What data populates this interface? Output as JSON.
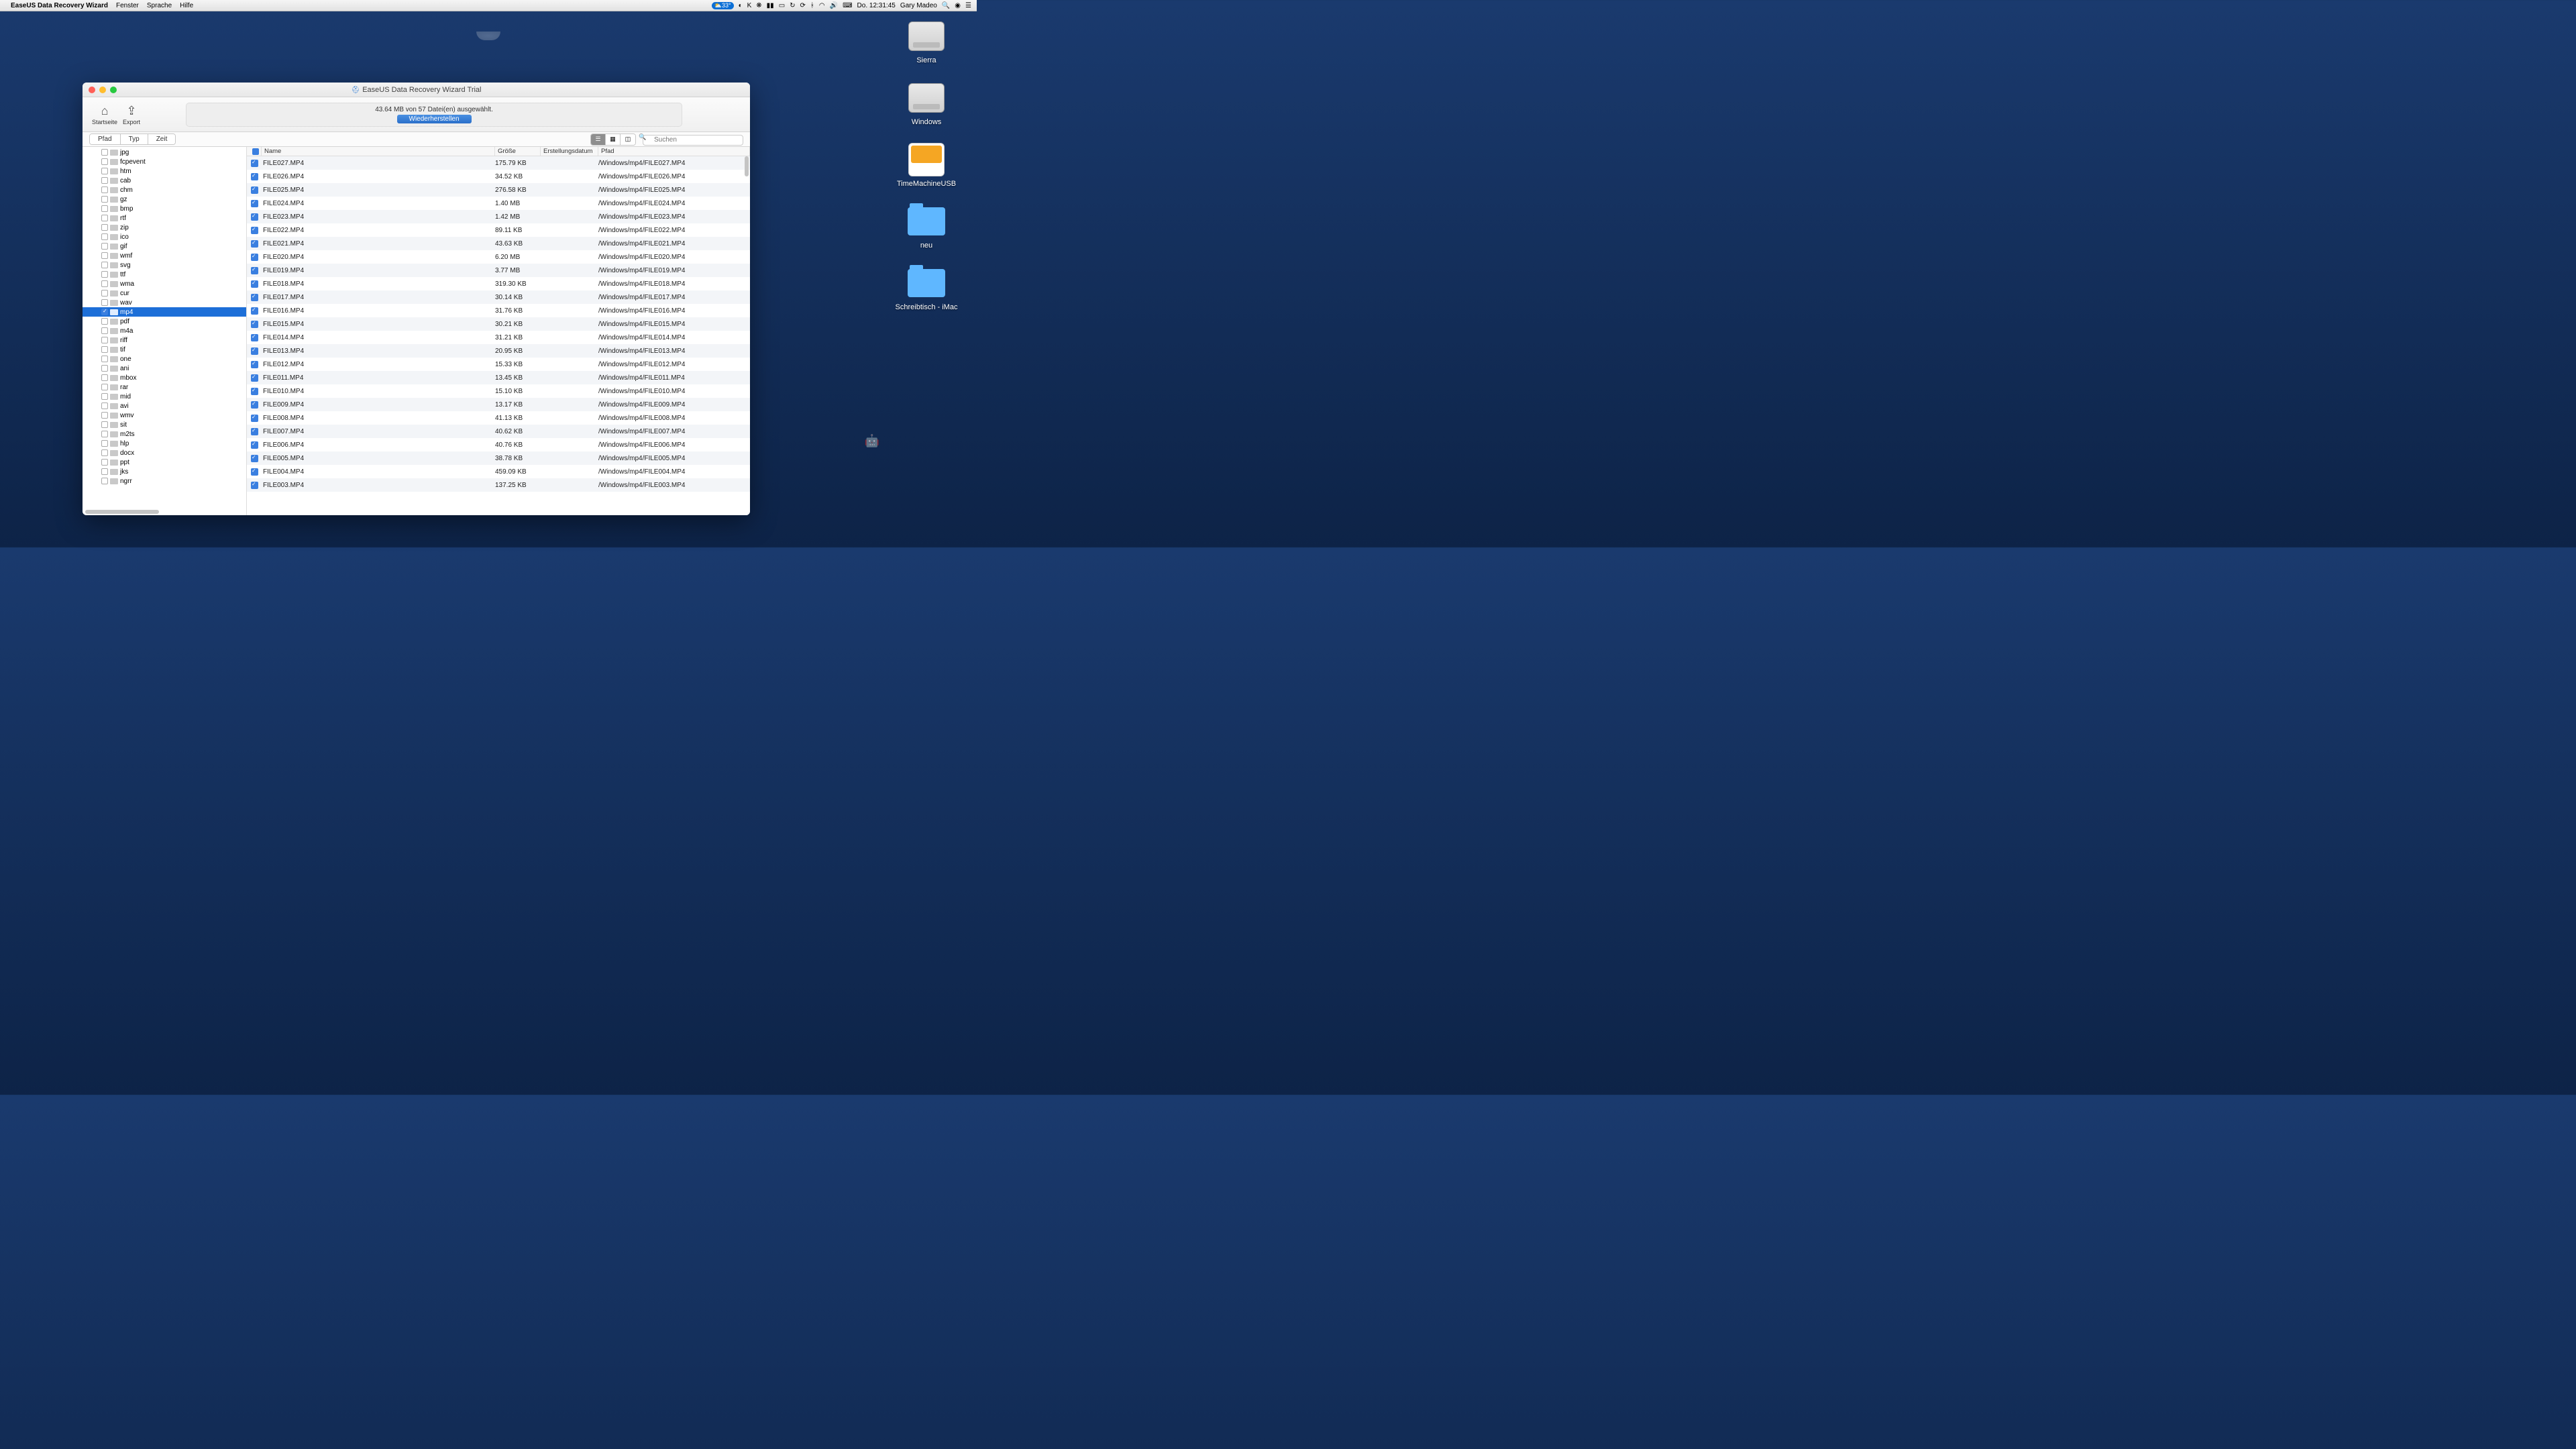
{
  "menubar": {
    "app_name": "EaseUS Data Recovery Wizard",
    "menus": [
      "Fenster",
      "Sprache",
      "Hilfe"
    ],
    "right": {
      "badge": "⛅33°",
      "clock": "Do. 12:31:45",
      "user": "Gary Madeo"
    }
  },
  "desktop": [
    {
      "label": "Sierra",
      "type": "hdd"
    },
    {
      "label": "Windows",
      "type": "hdd"
    },
    {
      "label": "TimeMachineUSB",
      "type": "ext"
    },
    {
      "label": "neu",
      "type": "folder"
    },
    {
      "label": "Schreibtisch - iMac",
      "type": "folder"
    }
  ],
  "window": {
    "title": "EaseUS Data Recovery Wizard Trial",
    "toolbar": {
      "home": "Startseite",
      "export": "Export",
      "status": "43.64 MB von 57 Datei(en) ausgewählt.",
      "recover": "Wiederherstellen"
    },
    "tabs": {
      "pfad": "Pfad",
      "typ": "Typ",
      "zeit": "Zeit"
    },
    "search_placeholder": "Suchen",
    "columns": {
      "name": "Name",
      "size": "Größe",
      "date": "Erstellungsdatum",
      "path": "Pfad"
    },
    "sidebar_items": [
      {
        "name": "jpg",
        "sel": false,
        "chk": false
      },
      {
        "name": "fcpevent",
        "sel": false,
        "chk": false
      },
      {
        "name": "htm",
        "sel": false,
        "chk": false
      },
      {
        "name": "cab",
        "sel": false,
        "chk": false
      },
      {
        "name": "chm",
        "sel": false,
        "chk": false
      },
      {
        "name": "gz",
        "sel": false,
        "chk": false
      },
      {
        "name": "bmp",
        "sel": false,
        "chk": false
      },
      {
        "name": "rtf",
        "sel": false,
        "chk": false
      },
      {
        "name": "zip",
        "sel": false,
        "chk": false
      },
      {
        "name": "ico",
        "sel": false,
        "chk": false
      },
      {
        "name": "gif",
        "sel": false,
        "chk": false
      },
      {
        "name": "wmf",
        "sel": false,
        "chk": false
      },
      {
        "name": "svg",
        "sel": false,
        "chk": false
      },
      {
        "name": "ttf",
        "sel": false,
        "chk": false
      },
      {
        "name": "wma",
        "sel": false,
        "chk": false
      },
      {
        "name": "cur",
        "sel": false,
        "chk": false
      },
      {
        "name": "wav",
        "sel": false,
        "chk": false
      },
      {
        "name": "mp4",
        "sel": true,
        "chk": true
      },
      {
        "name": "pdf",
        "sel": false,
        "chk": false
      },
      {
        "name": "m4a",
        "sel": false,
        "chk": false
      },
      {
        "name": "riff",
        "sel": false,
        "chk": false
      },
      {
        "name": "tif",
        "sel": false,
        "chk": false
      },
      {
        "name": "one",
        "sel": false,
        "chk": false
      },
      {
        "name": "ani",
        "sel": false,
        "chk": false
      },
      {
        "name": "mbox",
        "sel": false,
        "chk": false
      },
      {
        "name": "rar",
        "sel": false,
        "chk": false
      },
      {
        "name": "mid",
        "sel": false,
        "chk": false
      },
      {
        "name": "avi",
        "sel": false,
        "chk": false
      },
      {
        "name": "wmv",
        "sel": false,
        "chk": false
      },
      {
        "name": "sit",
        "sel": false,
        "chk": false
      },
      {
        "name": "m2ts",
        "sel": false,
        "chk": false
      },
      {
        "name": "hlp",
        "sel": false,
        "chk": false
      },
      {
        "name": "docx",
        "sel": false,
        "chk": false
      },
      {
        "name": "ppt",
        "sel": false,
        "chk": false
      },
      {
        "name": "jks",
        "sel": false,
        "chk": false
      },
      {
        "name": "ngrr",
        "sel": false,
        "chk": false
      }
    ],
    "files": [
      {
        "name": "FILE027.MP4",
        "size": "175.79 KB",
        "path": "/Windows/mp4/FILE027.MP4"
      },
      {
        "name": "FILE026.MP4",
        "size": "34.52 KB",
        "path": "/Windows/mp4/FILE026.MP4"
      },
      {
        "name": "FILE025.MP4",
        "size": "276.58 KB",
        "path": "/Windows/mp4/FILE025.MP4"
      },
      {
        "name": "FILE024.MP4",
        "size": "1.40 MB",
        "path": "/Windows/mp4/FILE024.MP4"
      },
      {
        "name": "FILE023.MP4",
        "size": "1.42 MB",
        "path": "/Windows/mp4/FILE023.MP4"
      },
      {
        "name": "FILE022.MP4",
        "size": "89.11 KB",
        "path": "/Windows/mp4/FILE022.MP4"
      },
      {
        "name": "FILE021.MP4",
        "size": "43.63 KB",
        "path": "/Windows/mp4/FILE021.MP4"
      },
      {
        "name": "FILE020.MP4",
        "size": "6.20 MB",
        "path": "/Windows/mp4/FILE020.MP4"
      },
      {
        "name": "FILE019.MP4",
        "size": "3.77 MB",
        "path": "/Windows/mp4/FILE019.MP4"
      },
      {
        "name": "FILE018.MP4",
        "size": "319.30 KB",
        "path": "/Windows/mp4/FILE018.MP4"
      },
      {
        "name": "FILE017.MP4",
        "size": "30.14 KB",
        "path": "/Windows/mp4/FILE017.MP4"
      },
      {
        "name": "FILE016.MP4",
        "size": "31.76 KB",
        "path": "/Windows/mp4/FILE016.MP4"
      },
      {
        "name": "FILE015.MP4",
        "size": "30.21 KB",
        "path": "/Windows/mp4/FILE015.MP4"
      },
      {
        "name": "FILE014.MP4",
        "size": "31.21 KB",
        "path": "/Windows/mp4/FILE014.MP4"
      },
      {
        "name": "FILE013.MP4",
        "size": "20.95 KB",
        "path": "/Windows/mp4/FILE013.MP4"
      },
      {
        "name": "FILE012.MP4",
        "size": "15.33 KB",
        "path": "/Windows/mp4/FILE012.MP4"
      },
      {
        "name": "FILE011.MP4",
        "size": "13.45 KB",
        "path": "/Windows/mp4/FILE011.MP4"
      },
      {
        "name": "FILE010.MP4",
        "size": "15.10 KB",
        "path": "/Windows/mp4/FILE010.MP4"
      },
      {
        "name": "FILE009.MP4",
        "size": "13.17 KB",
        "path": "/Windows/mp4/FILE009.MP4"
      },
      {
        "name": "FILE008.MP4",
        "size": "41.13 KB",
        "path": "/Windows/mp4/FILE008.MP4"
      },
      {
        "name": "FILE007.MP4",
        "size": "40.62 KB",
        "path": "/Windows/mp4/FILE007.MP4"
      },
      {
        "name": "FILE006.MP4",
        "size": "40.76 KB",
        "path": "/Windows/mp4/FILE006.MP4"
      },
      {
        "name": "FILE005.MP4",
        "size": "38.78 KB",
        "path": "/Windows/mp4/FILE005.MP4"
      },
      {
        "name": "FILE004.MP4",
        "size": "459.09 KB",
        "path": "/Windows/mp4/FILE004.MP4"
      },
      {
        "name": "FILE003.MP4",
        "size": "137.25 KB",
        "path": "/Windows/mp4/FILE003.MP4"
      }
    ]
  }
}
